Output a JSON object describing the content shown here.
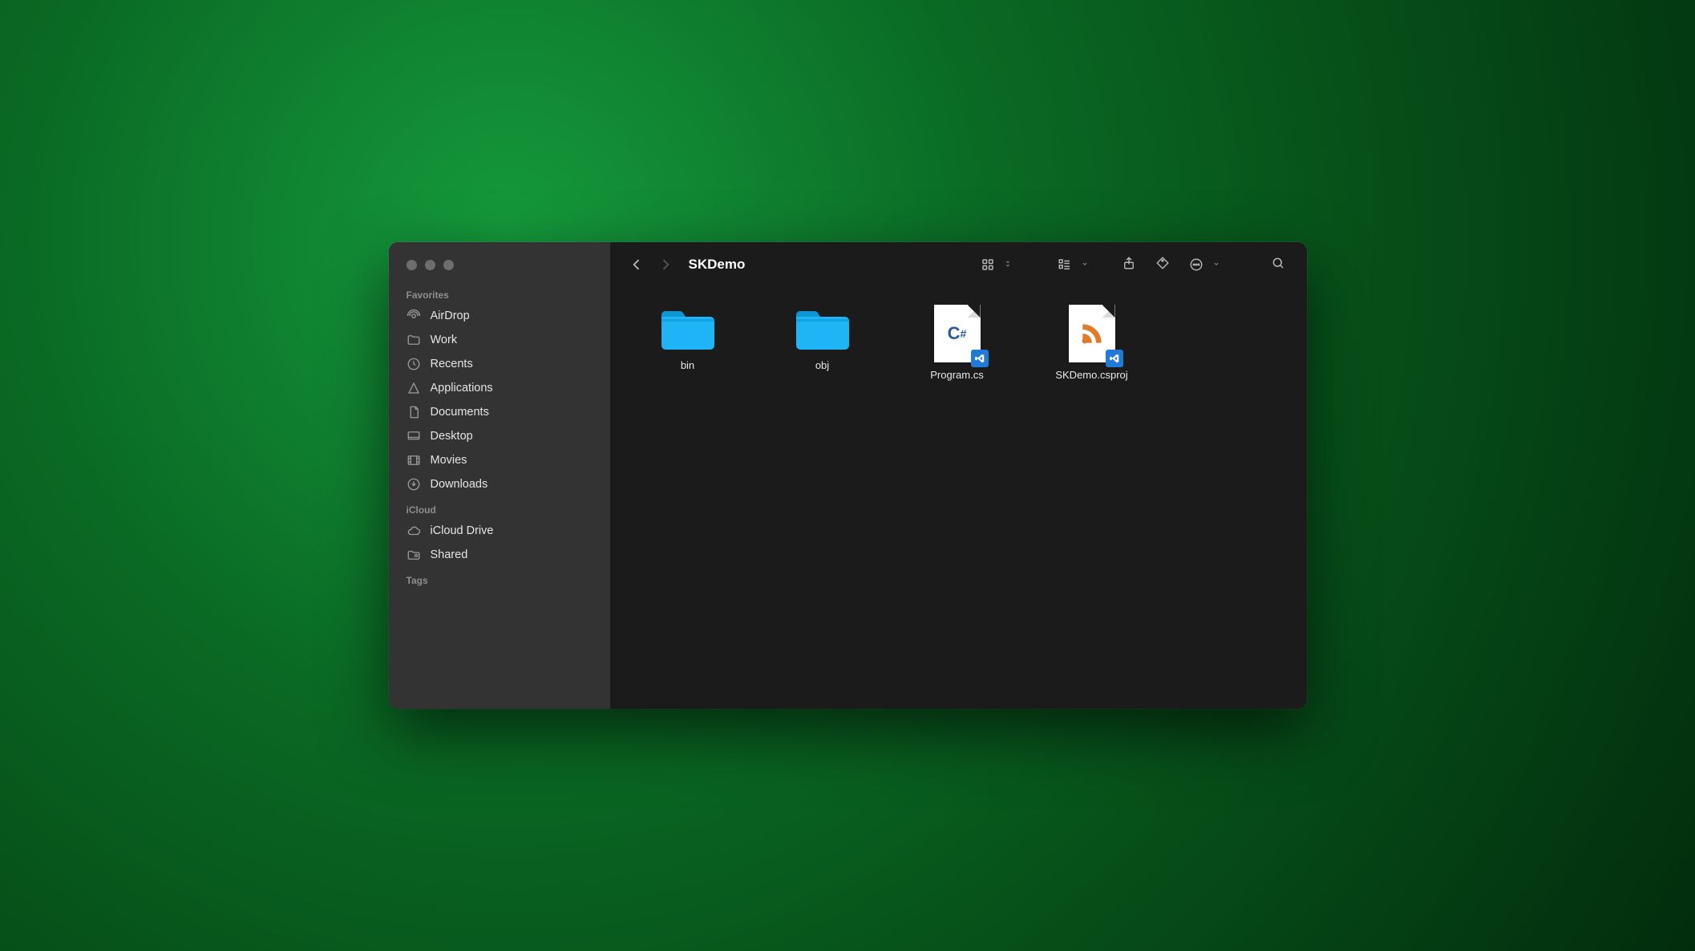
{
  "window": {
    "title": "SKDemo"
  },
  "sidebar": {
    "sections": {
      "favorites": {
        "title": "Favorites",
        "items": [
          {
            "icon": "airdrop-icon",
            "label": "AirDrop"
          },
          {
            "icon": "folder-icon",
            "label": "Work"
          },
          {
            "icon": "recents-icon",
            "label": "Recents"
          },
          {
            "icon": "applications-icon",
            "label": "Applications"
          },
          {
            "icon": "documents-icon",
            "label": "Documents"
          },
          {
            "icon": "desktop-icon",
            "label": "Desktop"
          },
          {
            "icon": "movies-icon",
            "label": "Movies"
          },
          {
            "icon": "downloads-icon",
            "label": "Downloads"
          }
        ]
      },
      "icloud": {
        "title": "iCloud",
        "items": [
          {
            "icon": "cloud-icon",
            "label": "iCloud Drive"
          },
          {
            "icon": "shared-icon",
            "label": "Shared"
          }
        ]
      },
      "tags": {
        "title": "Tags",
        "items": []
      }
    }
  },
  "toolbar": {
    "back_enabled": true,
    "forward_enabled": false
  },
  "items": [
    {
      "type": "folder",
      "name": "bin"
    },
    {
      "type": "folder",
      "name": "obj"
    },
    {
      "type": "file",
      "name": "Program.cs",
      "kind": "csharp"
    },
    {
      "type": "file",
      "name": "SKDemo.csproj",
      "kind": "csproj"
    }
  ],
  "colors": {
    "folder": "#1fb4f5",
    "csharp": "#2b5a97",
    "rss": "#e07b2b",
    "vscode_badge": "#1f7bd6"
  }
}
